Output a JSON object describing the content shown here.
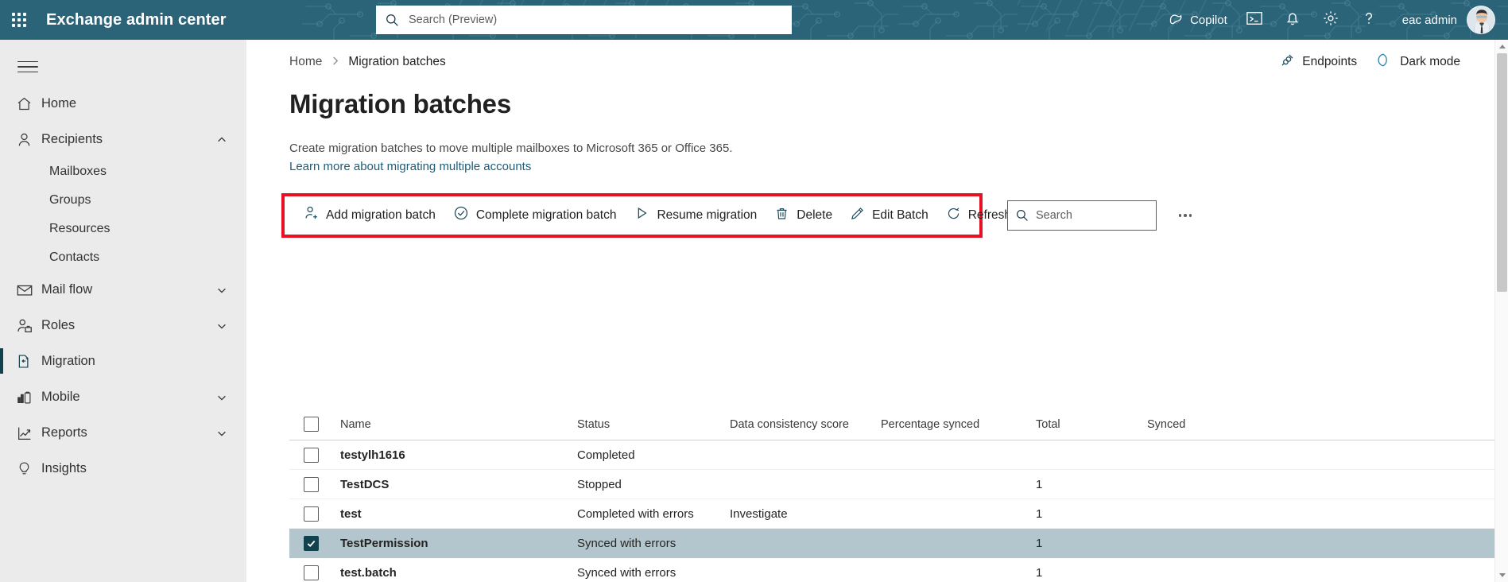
{
  "header": {
    "app_title": "Exchange admin center",
    "waffle_icon": "app-launcher-icon",
    "search": {
      "placeholder": "Search (Preview)",
      "value": "",
      "icon": "search-icon"
    },
    "copilot_label": "Copilot",
    "icons": {
      "copilot": "copilot-icon",
      "terminal": "terminal-icon",
      "notifications": "bell-icon",
      "settings": "gear-icon",
      "help": "question-mark-icon"
    },
    "user_name": "eac admin",
    "avatar": "user-avatar"
  },
  "sidebar": {
    "hamburger_icon": "hamburger-menu-icon",
    "items": [
      {
        "label": "Home",
        "icon": "home-icon",
        "level": "top",
        "expandable": false,
        "selected": false
      },
      {
        "label": "Recipients",
        "icon": "person-icon",
        "level": "top",
        "expandable": true,
        "expanded": true,
        "selected": false
      },
      {
        "label": "Mailboxes",
        "icon": "",
        "level": "sub",
        "expandable": false,
        "selected": false
      },
      {
        "label": "Groups",
        "icon": "",
        "level": "sub",
        "expandable": false,
        "selected": false
      },
      {
        "label": "Resources",
        "icon": "",
        "level": "sub",
        "expandable": false,
        "selected": false
      },
      {
        "label": "Contacts",
        "icon": "",
        "level": "sub",
        "expandable": false,
        "selected": false
      },
      {
        "label": "Mail flow",
        "icon": "envelope-icon",
        "level": "top",
        "expandable": true,
        "expanded": false,
        "selected": false
      },
      {
        "label": "Roles",
        "icon": "person-briefcase-icon",
        "level": "top",
        "expandable": true,
        "expanded": false,
        "selected": false
      },
      {
        "label": "Migration",
        "icon": "migration-icon",
        "level": "top",
        "expandable": false,
        "selected": true
      },
      {
        "label": "Mobile",
        "icon": "mobile-device-icon",
        "level": "top",
        "expandable": true,
        "expanded": false,
        "selected": false
      },
      {
        "label": "Reports",
        "icon": "reports-chart-icon",
        "level": "top",
        "expandable": true,
        "expanded": false,
        "selected": false
      },
      {
        "label": "Insights",
        "icon": "lightbulb-icon",
        "level": "top",
        "expandable": false,
        "selected": false
      }
    ]
  },
  "breadcrumb": {
    "home": "Home",
    "separator": ">",
    "current": "Migration batches"
  },
  "page_actions": [
    {
      "label": "Endpoints",
      "icon": "endpoints-plug-icon"
    },
    {
      "label": "Dark mode",
      "icon": "moon-icon"
    }
  ],
  "page": {
    "title": "Migration batches",
    "description": "Create migration batches to move multiple mailboxes to Microsoft 365 or Office 365.",
    "link_text": "Learn more about migrating multiple accounts"
  },
  "toolbar": {
    "highlight_color": "#e81123",
    "buttons": [
      {
        "label": "Add migration batch",
        "icon": "add-user-icon"
      },
      {
        "label": "Complete migration batch",
        "icon": "check-circle-icon"
      },
      {
        "label": "Resume migration",
        "icon": "play-triangle-icon"
      },
      {
        "label": "Delete",
        "icon": "trash-icon"
      },
      {
        "label": "Edit Batch",
        "icon": "pencil-icon"
      },
      {
        "label": "Refresh",
        "icon": "refresh-icon"
      }
    ],
    "search": {
      "placeholder": "Search",
      "value": "",
      "icon": "search-icon"
    },
    "overflow_icon": "more-ellipsis-icon"
  },
  "table": {
    "columns": [
      "Name",
      "Status",
      "Data consistency score",
      "Percentage synced",
      "Total",
      "Synced"
    ],
    "select_all_checked": false,
    "rows": [
      {
        "checked": false,
        "name": "testylh1616",
        "status": "Completed",
        "dcs": "",
        "pct": "",
        "total": "",
        "synced": ""
      },
      {
        "checked": false,
        "name": "TestDCS",
        "status": "Stopped",
        "dcs": "",
        "pct": "",
        "total": "1",
        "synced": ""
      },
      {
        "checked": false,
        "name": "test",
        "status": "Completed with errors",
        "dcs": "Investigate",
        "pct": "",
        "total": "1",
        "synced": ""
      },
      {
        "checked": true,
        "name": "TestPermission",
        "status": "Synced with errors",
        "dcs": "",
        "pct": "",
        "total": "1",
        "synced": ""
      },
      {
        "checked": false,
        "name": "test.batch",
        "status": "Synced with errors",
        "dcs": "",
        "pct": "",
        "total": "1",
        "synced": ""
      }
    ]
  }
}
